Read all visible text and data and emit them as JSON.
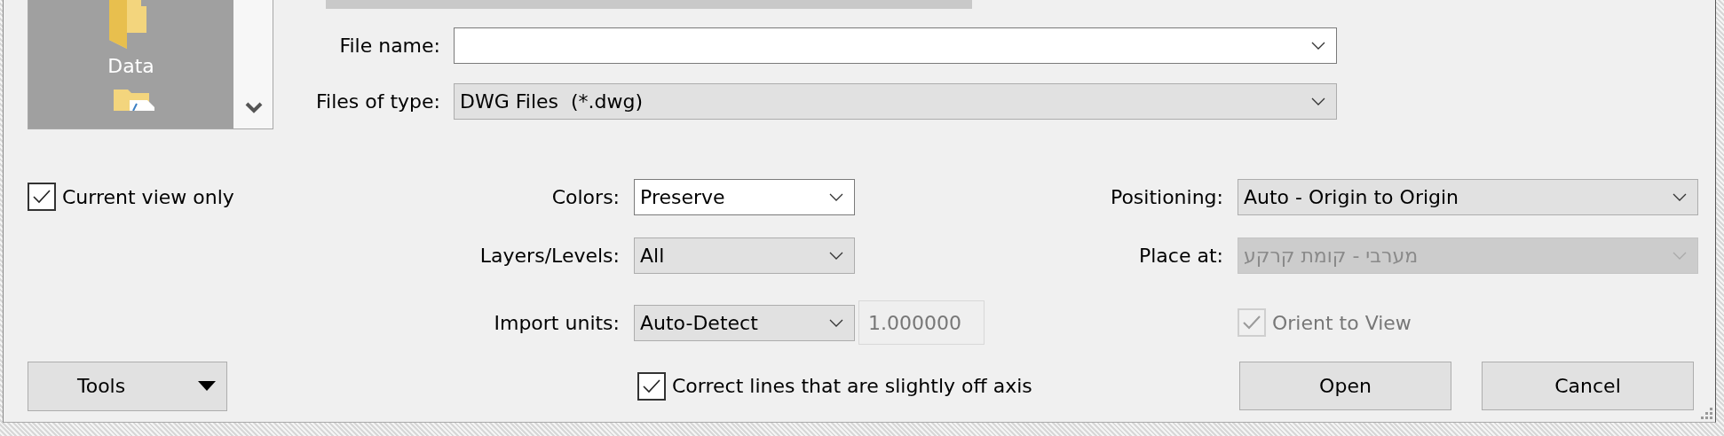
{
  "places": {
    "items": [
      {
        "label": "Data"
      }
    ]
  },
  "file_name": {
    "label": "File name:"
  },
  "files_of_type": {
    "label": "Files of type:",
    "value": "DWG Files  (*.dwg)"
  },
  "current_view_only": {
    "label": "Current view only",
    "checked": true
  },
  "colors": {
    "label": "Colors:",
    "value": "Preserve"
  },
  "layers_levels": {
    "label": "Layers/Levels:",
    "value": "All"
  },
  "import_units": {
    "label": "Import units:",
    "value": "Auto-Detect",
    "factor": "1.000000"
  },
  "correct_lines": {
    "label": "Correct lines that are slightly off axis",
    "checked": true
  },
  "positioning": {
    "label": "Positioning:",
    "value": "Auto - Origin to Origin"
  },
  "place_at": {
    "label": "Place at:",
    "value": "מערבי - קומת קרקע",
    "disabled": true
  },
  "orient_to_view": {
    "label": "Orient to View",
    "checked": true,
    "disabled": true
  },
  "tools_button": {
    "label": "Tools"
  },
  "buttons": [
    {
      "label": "Open"
    },
    {
      "label": "Cancel"
    }
  ]
}
